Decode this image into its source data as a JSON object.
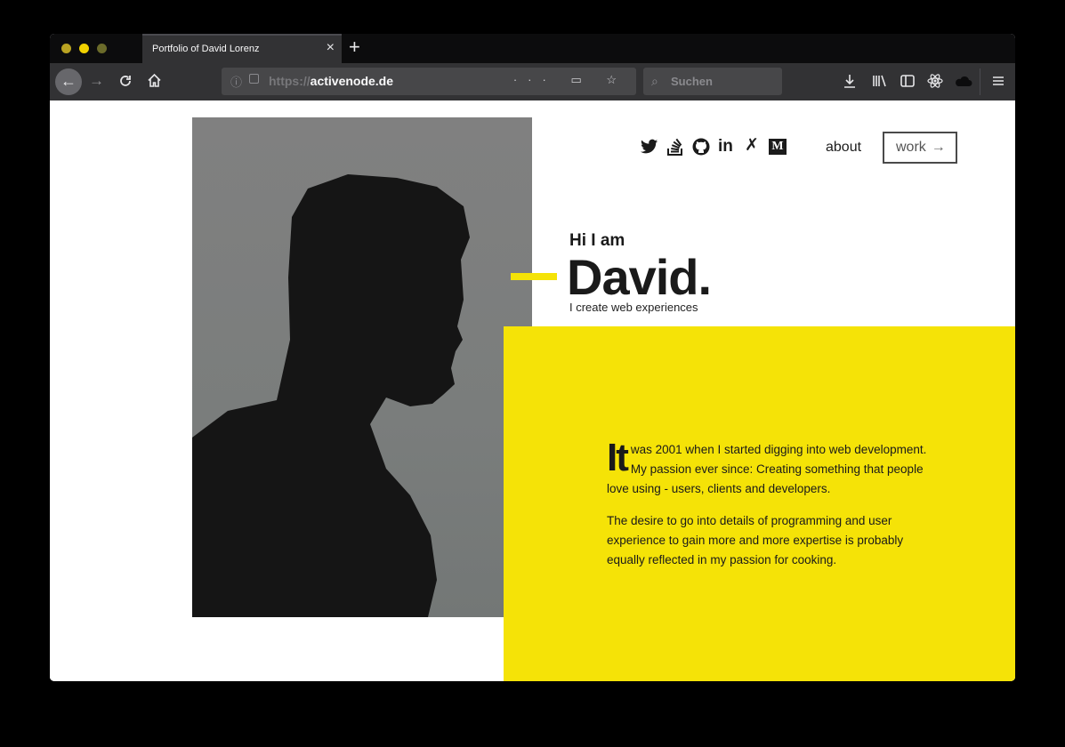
{
  "browser": {
    "tab_title": "Portfolio of David Lorenz",
    "tab_close": "×",
    "new_tab": "+",
    "url_protocol": "https://",
    "url_host": "activenode.de",
    "url_actions": "··· ▭ ☆",
    "search_placeholder": "Suchen",
    "toolbar_icons": [
      "download-icon",
      "library-icon",
      "sidebar-icon",
      "react-devtools-icon",
      "cloud-icon",
      "menu-icon"
    ]
  },
  "nav": {
    "social_icons": [
      "twitter-icon",
      "stackoverflow-icon",
      "github-icon",
      "linkedin-icon",
      "xing-icon",
      "medium-icon"
    ],
    "about_label": "about",
    "work_label": "work",
    "work_arrow": "→"
  },
  "hero": {
    "greeting": "Hi I am",
    "name": "David.",
    "tagline": "I create web experiences"
  },
  "bio": {
    "dropcap": "It",
    "paragraph1_rest": " was 2001 when I started digging into web development. My passion ever since: Creating something that people love using - users, clients and developers.",
    "paragraph2": "The desire to go into details of programming and user experience to gain more and more expertise is probably equally reflected in my passion for cooking."
  },
  "colors": {
    "accent_yellow": "#f5e307",
    "browser_dark": "#323234"
  }
}
